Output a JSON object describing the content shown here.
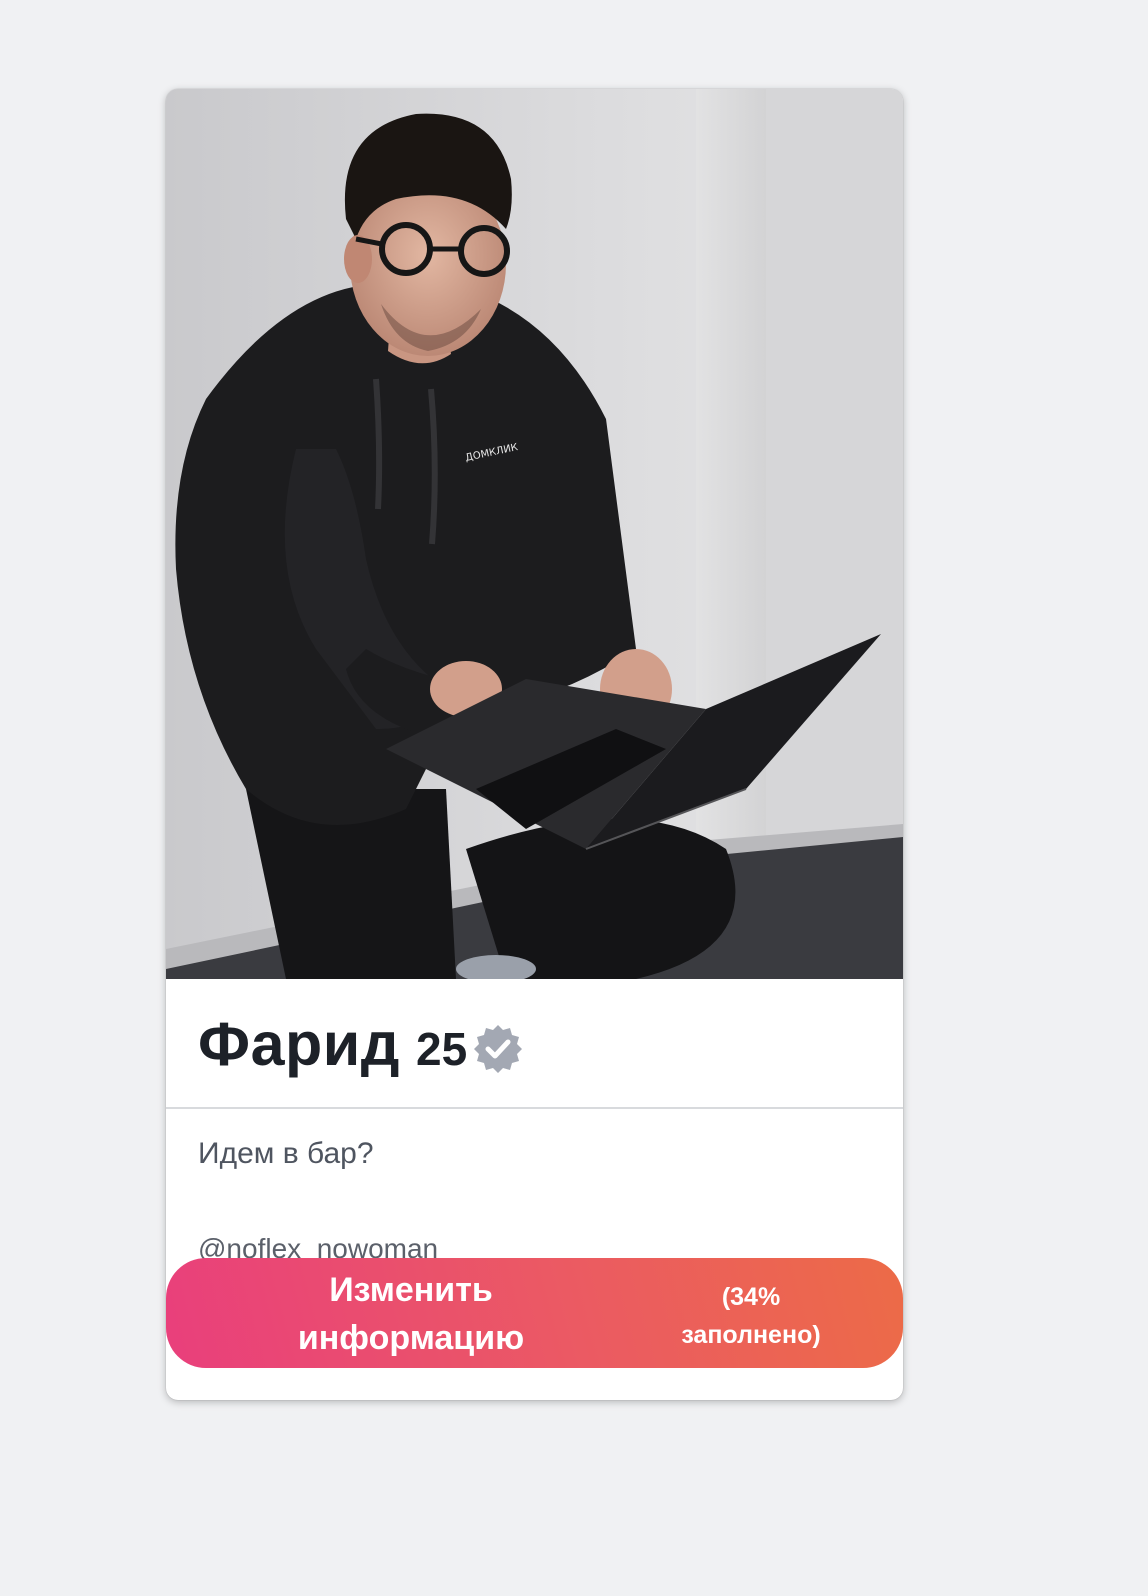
{
  "profile": {
    "name": "Фарид",
    "age": "25",
    "bio": "Идем в бар?",
    "handle": "@noflex_nowoman",
    "photo_description": "verified-badge-icon",
    "hoodie_logo": "ДОМКЛИК"
  },
  "edit_button": {
    "line1": "Изменить",
    "line2": "информацию",
    "pct_line1": "(34%",
    "pct_line2": "заполнено)",
    "completion_percent": 34
  },
  "colors": {
    "gradient_start": "#e93f7c",
    "gradient_end": "#ec6b47",
    "name_text": "#1d2128",
    "page_background": "#f0f1f3"
  }
}
